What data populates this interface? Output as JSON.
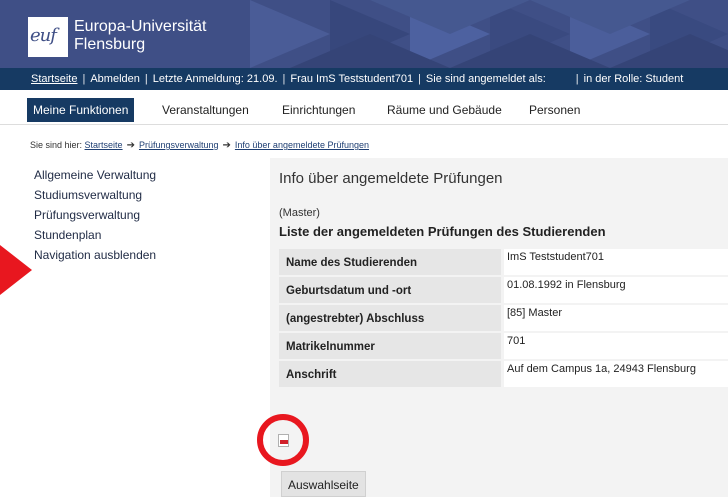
{
  "header": {
    "logo_text": "euf",
    "university_name_line1": "Europa-Universität",
    "university_name_line2": "Flensburg"
  },
  "statusbar": {
    "home": "Startseite",
    "logout": "Abmelden",
    "last_login": "Letzte Anmeldung: 21.09.",
    "user": "Frau ImS Teststudent701",
    "logged_in_as": "Sie sind angemeldet als:",
    "role": "in der Rolle: Student"
  },
  "mainnav": {
    "items": [
      "Meine Funktionen",
      "Veranstaltungen",
      "Einrichtungen",
      "Räume und Gebäude",
      "Personen"
    ]
  },
  "breadcrumb": {
    "prefix": "Sie sind hier:",
    "items": [
      "Startseite",
      "Prüfungsverwaltung",
      "Info über angemeldete Prüfungen"
    ]
  },
  "sidenav": {
    "items": [
      "Allgemeine Verwaltung",
      "Studiumsverwaltung",
      "Prüfungsverwaltung",
      "Stundenplan",
      "Navigation ausblenden"
    ]
  },
  "content": {
    "title": "Info über angemeldete Prüfungen",
    "degree": "(Master)",
    "list_heading": "Liste der angemeldeten Prüfungen des Studierenden",
    "rows": [
      {
        "label": "Name des Studierenden",
        "value": "ImS Teststudent701"
      },
      {
        "label": "Geburtsdatum und -ort",
        "value": "01.08.1992 in Flensburg"
      },
      {
        "label": "(angestrebter) Abschluss",
        "value": "[85] Master"
      },
      {
        "label": "Matrikelnummer",
        "value": "701"
      },
      {
        "label": "Anschrift",
        "value": "Auf dem Campus 1a, 24943 Flensburg"
      }
    ],
    "button_label": "Auswahlseite"
  },
  "colors": {
    "banner": "#3f4f86",
    "statusbar": "#163a63",
    "annotation_red": "#e8171f"
  }
}
